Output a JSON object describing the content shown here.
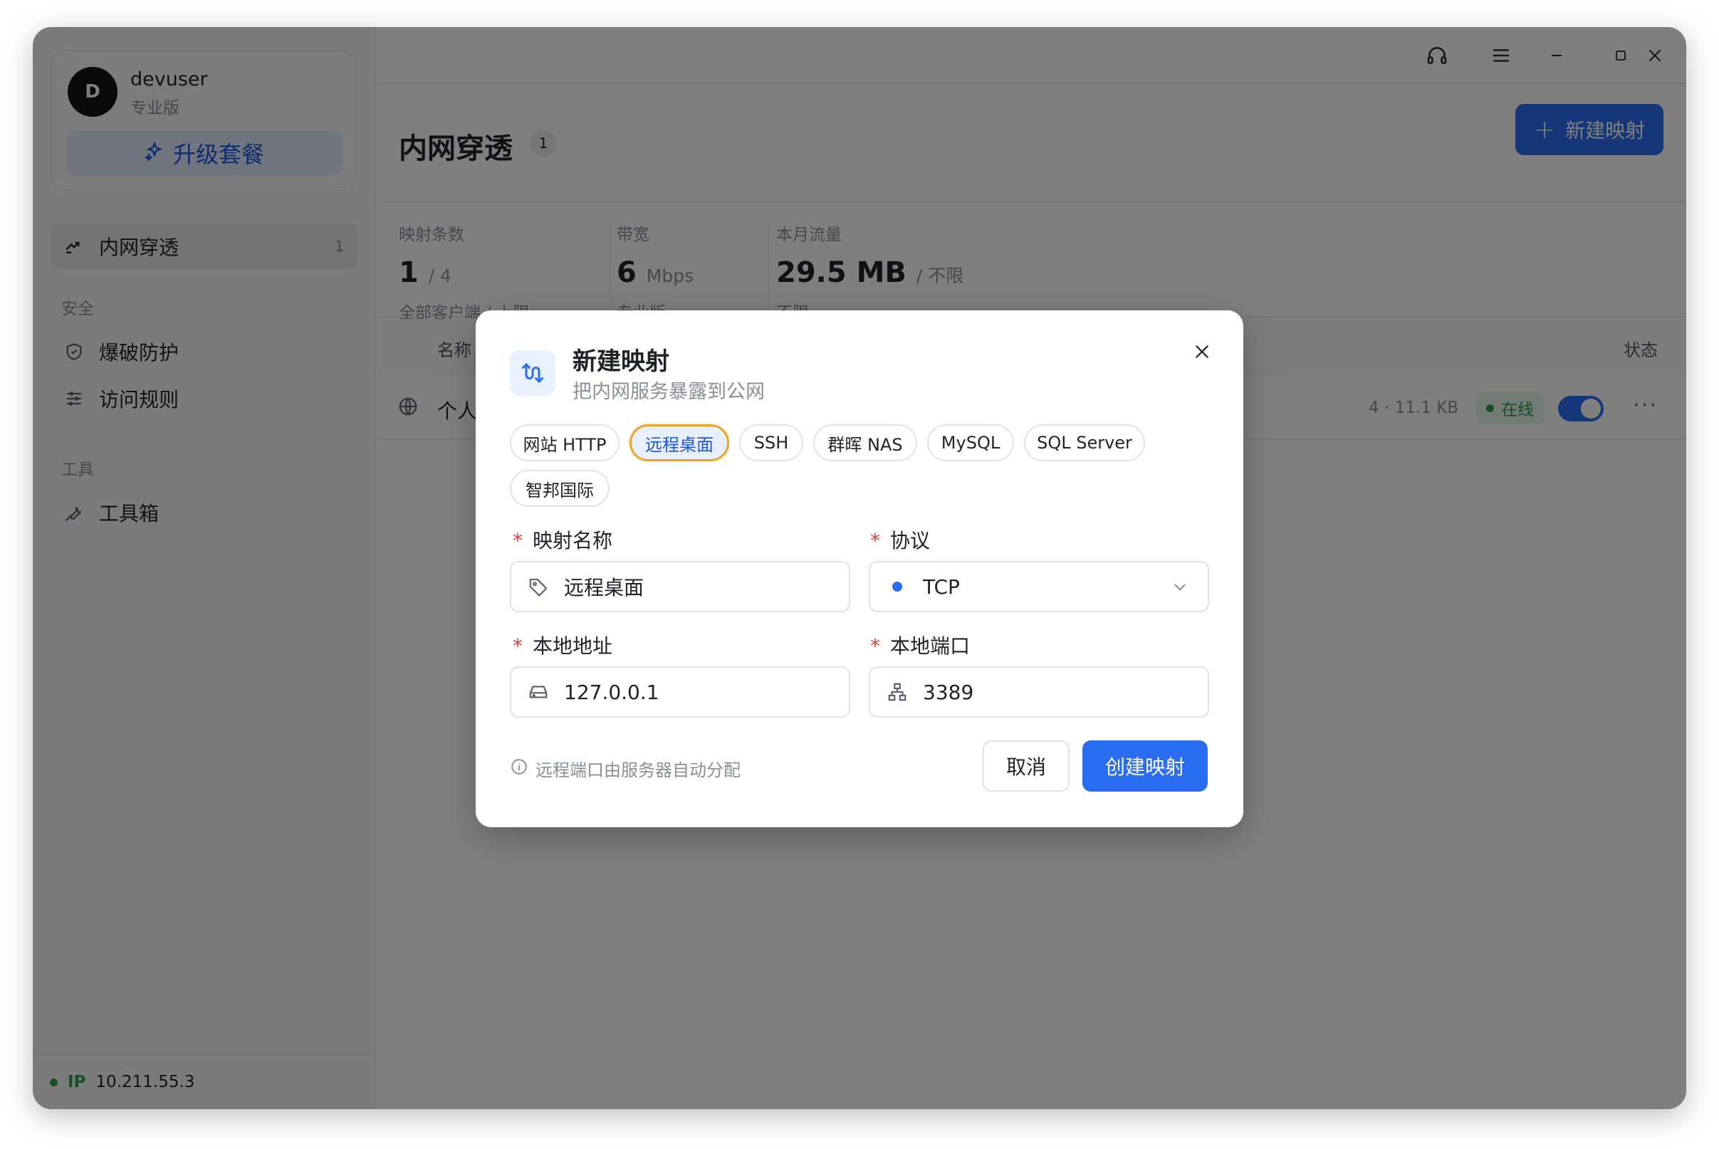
{
  "sidebar": {
    "user": {
      "avatar_letter": "D",
      "name": "devuser",
      "plan": "专业版"
    },
    "upgrade_label": "升级套餐",
    "items": [
      {
        "label": "内网穿透",
        "count": "1"
      }
    ],
    "sections": [
      {
        "title": "安全",
        "items": [
          "爆破防护",
          "访问规则"
        ]
      },
      {
        "title": "工具",
        "items": [
          "工具箱"
        ]
      }
    ],
    "footer": {
      "ip_label": "IP",
      "ip": "10.211.55.3"
    }
  },
  "header": {
    "title": "内网穿透",
    "count": "1",
    "new_button": "新建映射"
  },
  "stats": [
    {
      "label": "映射条数",
      "value": "1",
      "unit": "/ 4",
      "sub": "全部客户端 / 上限"
    },
    {
      "label": "带宽",
      "value": "6",
      "unit": "Mbps",
      "sub": "专业版"
    },
    {
      "label": "本月流量",
      "value": "29.5 MB",
      "unit": "/ 不限",
      "sub": "不限"
    }
  ],
  "table": {
    "columns": {
      "name": "名称",
      "status": "状态"
    },
    "rows": [
      {
        "name": "个人",
        "traffic": "4 · 11.1 KB",
        "status": "在线"
      }
    ]
  },
  "dialog": {
    "title": "新建映射",
    "subtitle": "把内网服务暴露到公网",
    "presets": [
      "网站 HTTP",
      "远程桌面",
      "SSH",
      "群晖 NAS",
      "MySQL",
      "SQL Server",
      "智邦国际"
    ],
    "selected_preset": "远程桌面",
    "fields": {
      "name": {
        "label": "映射名称",
        "value": "远程桌面"
      },
      "protocol": {
        "label": "协议",
        "value": "TCP"
      },
      "local_addr": {
        "label": "本地地址",
        "value": "127.0.0.1"
      },
      "local_port": {
        "label": "本地端口",
        "value": "3389"
      }
    },
    "hint": "远程端口由服务器自动分配",
    "cancel": "取消",
    "create": "创建映射"
  },
  "colors": {
    "accent": "#2b6df0",
    "online": "#2a9d4b",
    "required": "#e03e3e",
    "focus": "#e9a52a"
  }
}
